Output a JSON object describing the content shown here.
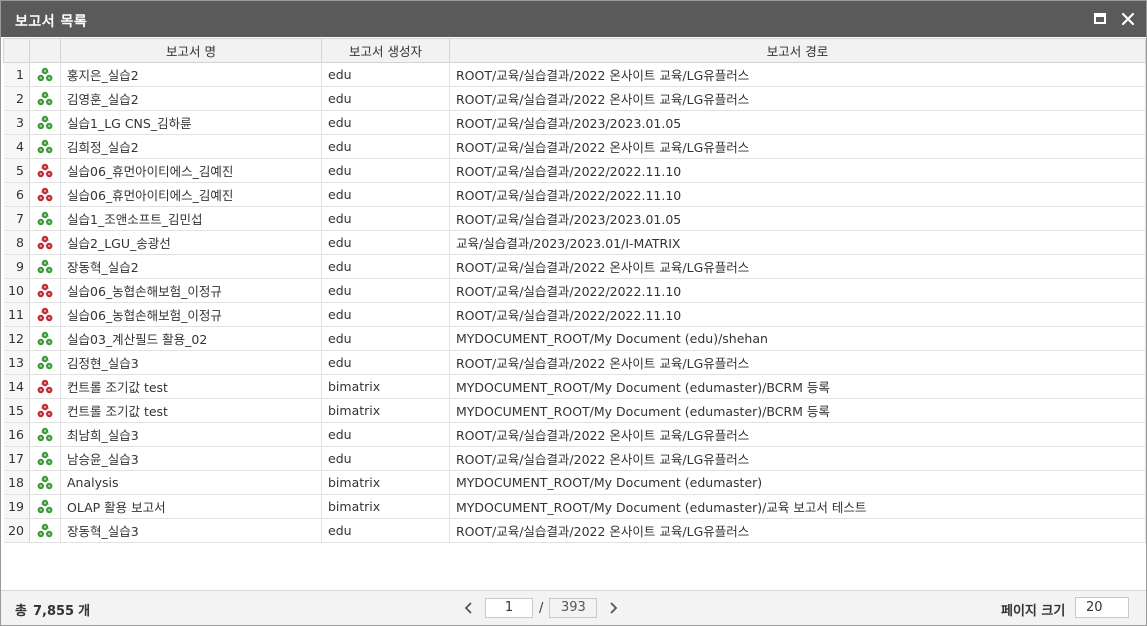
{
  "window": {
    "title": "보고서 목록"
  },
  "table": {
    "headers": {
      "name": "보고서 명",
      "creator": "보고서 생성자",
      "path": "보고서 경로"
    },
    "rows": [
      {
        "num": "1",
        "icon": "green-report-icon",
        "name": "홍지은_실습2",
        "creator": "edu",
        "path": "ROOT/교육/실습결과/2022 온사이트 교육/LG유플러스"
      },
      {
        "num": "2",
        "icon": "green-report-icon",
        "name": "김영훈_실습2",
        "creator": "edu",
        "path": "ROOT/교육/실습결과/2022 온사이트 교육/LG유플러스"
      },
      {
        "num": "3",
        "icon": "green-report-icon",
        "name": "실습1_LG CNS_김하륜",
        "creator": "edu",
        "path": "ROOT/교육/실습결과/2023/2023.01.05"
      },
      {
        "num": "4",
        "icon": "green-report-icon",
        "name": "김희정_실습2",
        "creator": "edu",
        "path": "ROOT/교육/실습결과/2022 온사이트 교육/LG유플러스"
      },
      {
        "num": "5",
        "icon": "red-report-icon",
        "name": "실습06_휴먼아이티에스_김예진",
        "creator": "edu",
        "path": "ROOT/교육/실습결과/2022/2022.11.10"
      },
      {
        "num": "6",
        "icon": "red-report-icon",
        "name": "실습06_휴먼아이티에스_김예진",
        "creator": "edu",
        "path": "ROOT/교육/실습결과/2022/2022.11.10"
      },
      {
        "num": "7",
        "icon": "green-report-icon",
        "name": "실습1_조앤소프트_김민섭",
        "creator": "edu",
        "path": "ROOT/교육/실습결과/2023/2023.01.05"
      },
      {
        "num": "8",
        "icon": "red-report-icon",
        "name": "실습2_LGU_송광선",
        "creator": "edu",
        "path": "교육/실습결과/2023/2023.01/I-MATRIX"
      },
      {
        "num": "9",
        "icon": "green-report-icon",
        "name": "장동혁_실습2",
        "creator": "edu",
        "path": "ROOT/교육/실습결과/2022 온사이트 교육/LG유플러스"
      },
      {
        "num": "10",
        "icon": "red-report-icon",
        "name": "실습06_농협손해보험_이정규",
        "creator": "edu",
        "path": "ROOT/교육/실습결과/2022/2022.11.10"
      },
      {
        "num": "11",
        "icon": "red-report-icon",
        "name": "실습06_농협손해보험_이정규",
        "creator": "edu",
        "path": "ROOT/교육/실습결과/2022/2022.11.10"
      },
      {
        "num": "12",
        "icon": "green-report-icon",
        "name": "실습03_계산필드 활용_02",
        "creator": "edu",
        "path": "MYDOCUMENT_ROOT/My Document (edu)/shehan"
      },
      {
        "num": "13",
        "icon": "green-report-icon",
        "name": "김정현_실습3",
        "creator": "edu",
        "path": "ROOT/교육/실습결과/2022 온사이트 교육/LG유플러스"
      },
      {
        "num": "14",
        "icon": "red-report-icon",
        "name": "컨트롤 조기값 test",
        "creator": "bimatrix",
        "path": "MYDOCUMENT_ROOT/My Document (edumaster)/BCRM 등록"
      },
      {
        "num": "15",
        "icon": "red-report-icon",
        "name": "컨트롤 조기값 test",
        "creator": "bimatrix",
        "path": "MYDOCUMENT_ROOT/My Document (edumaster)/BCRM 등록"
      },
      {
        "num": "16",
        "icon": "green-report-icon",
        "name": "최남희_실습3",
        "creator": "edu",
        "path": "ROOT/교육/실습결과/2022 온사이트 교육/LG유플러스"
      },
      {
        "num": "17",
        "icon": "green-report-icon",
        "name": "남승윤_실습3",
        "creator": "edu",
        "path": "ROOT/교육/실습결과/2022 온사이트 교육/LG유플러스"
      },
      {
        "num": "18",
        "icon": "green-report-icon",
        "name": "Analysis",
        "creator": "bimatrix",
        "path": "MYDOCUMENT_ROOT/My Document (edumaster)"
      },
      {
        "num": "19",
        "icon": "green-report-icon",
        "name": "OLAP 활용 보고서",
        "creator": "bimatrix",
        "path": "MYDOCUMENT_ROOT/My Document (edumaster)/교육 보고서 테스트"
      },
      {
        "num": "20",
        "icon": "green-report-icon",
        "name": "장동혁_실습3",
        "creator": "edu",
        "path": "ROOT/교육/실습결과/2022 온사이트 교육/LG유플러스"
      }
    ]
  },
  "footer": {
    "total_prefix": "총",
    "total_count": "7,855",
    "total_suffix": "개",
    "current_page": "1",
    "page_separator": "/",
    "total_pages": "393",
    "page_size_label": "페이지 크기",
    "page_size": "20"
  },
  "colors": {
    "titlebar": "#5a5a5a",
    "green_icon": "#3a9a34",
    "red_icon": "#c0282d"
  }
}
